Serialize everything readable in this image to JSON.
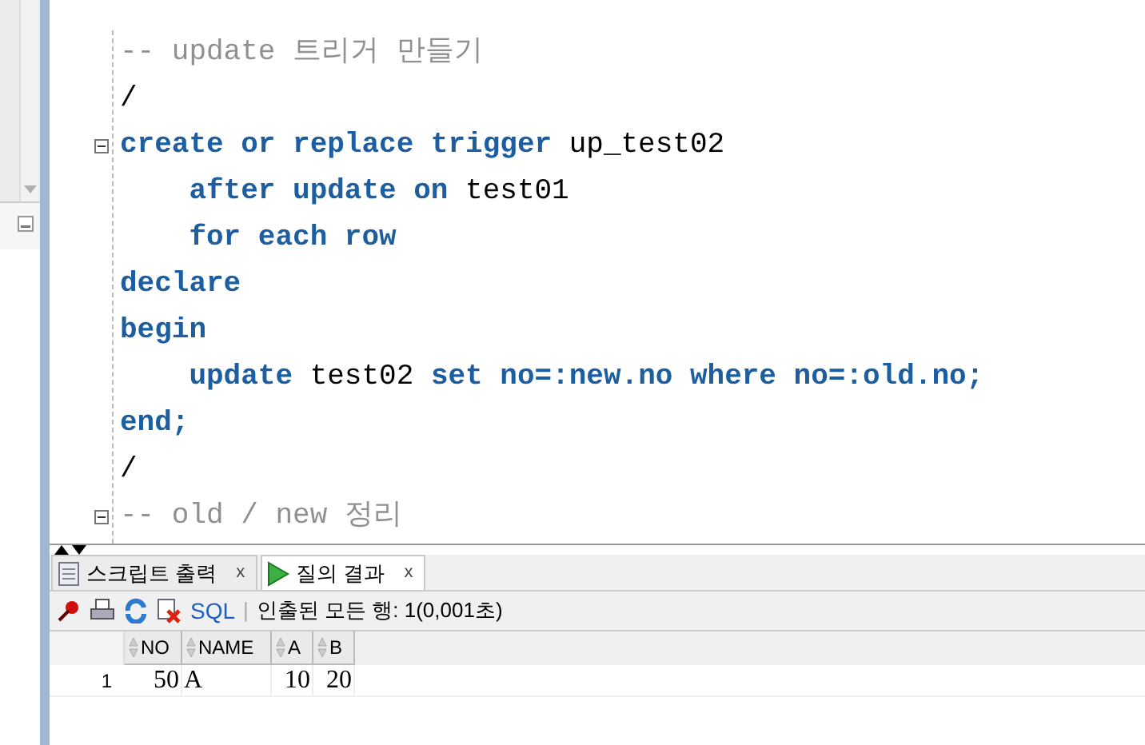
{
  "editor": {
    "lines": [
      {
        "fold": false,
        "tokens": [
          {
            "kind": "comment",
            "text": "-- update 트리거 만들기"
          }
        ]
      },
      {
        "fold": false,
        "tokens": [
          {
            "kind": "plain",
            "text": "/"
          }
        ]
      },
      {
        "fold": true,
        "tokens": [
          {
            "kind": "keyword",
            "text": "create or replace trigger"
          },
          {
            "kind": "plain",
            "text": " up_test02"
          }
        ]
      },
      {
        "fold": false,
        "tokens": [
          {
            "kind": "keyword",
            "text": "    after update on"
          },
          {
            "kind": "plain",
            "text": " test01"
          }
        ]
      },
      {
        "fold": false,
        "tokens": [
          {
            "kind": "keyword",
            "text": "    for each row"
          }
        ]
      },
      {
        "fold": false,
        "tokens": [
          {
            "kind": "keyword",
            "text": "declare"
          }
        ]
      },
      {
        "fold": false,
        "tokens": [
          {
            "kind": "keyword",
            "text": "begin"
          }
        ]
      },
      {
        "fold": false,
        "tokens": [
          {
            "kind": "keyword",
            "text": "    update"
          },
          {
            "kind": "plain",
            "text": " test02 "
          },
          {
            "kind": "keyword",
            "text": "set no=:new.no where no=:old.no;"
          }
        ]
      },
      {
        "fold": false,
        "tokens": [
          {
            "kind": "keyword",
            "text": "end;"
          }
        ]
      },
      {
        "fold": false,
        "tokens": [
          {
            "kind": "plain",
            "text": "/"
          }
        ]
      },
      {
        "fold": true,
        "tokens": [
          {
            "kind": "comment",
            "text": "-- old / new 정리"
          }
        ]
      }
    ]
  },
  "tabs": [
    {
      "label": "스크립트 출력",
      "close": "x",
      "selected": false,
      "kind": "script"
    },
    {
      "label": "질의 결과",
      "close": "x",
      "selected": true,
      "kind": "query"
    }
  ],
  "toolbar": {
    "sql": "SQL",
    "separator": "|",
    "status": "인출된 모든 행: 1(0,001초)"
  },
  "grid": {
    "columns": [
      "NO",
      "NAME",
      "A",
      "B"
    ],
    "rows": [
      {
        "number": "1",
        "cells": [
          "50",
          "A",
          "10",
          "20"
        ]
      }
    ]
  }
}
